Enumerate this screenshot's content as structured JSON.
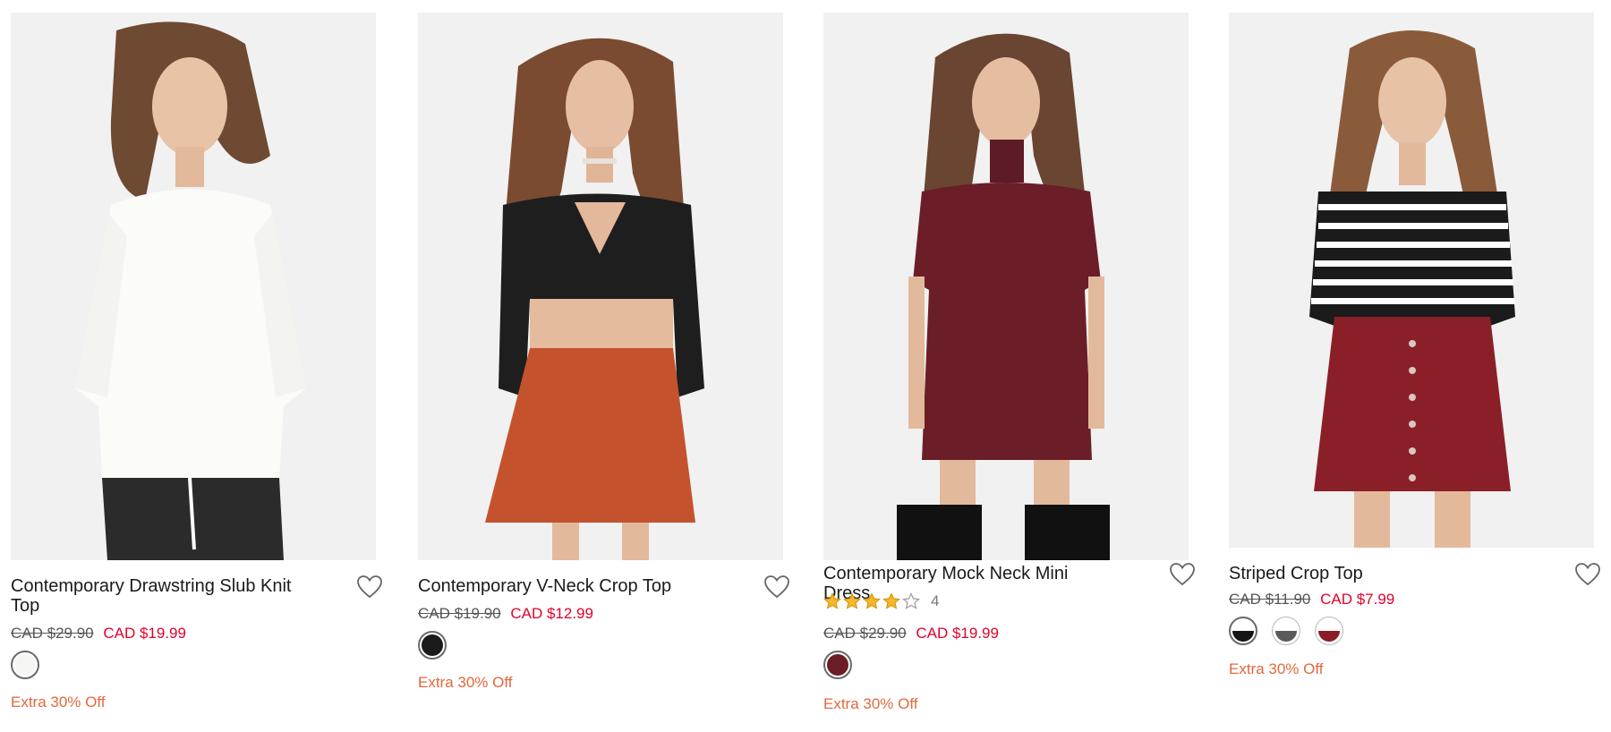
{
  "colors": {
    "sale": "#e4002b",
    "promo": "#e2683c",
    "star": "#f6b82a"
  },
  "products": [
    {
      "name": "Contemporary Drawstring Slub Knit Top",
      "price_original": "CAD $29.90",
      "price_sale": "CAD $19.99",
      "promo": "Extra 30% Off",
      "wishlist_icon": "heart-outline-icon",
      "swatches": [
        {
          "color": "#f6f6f4",
          "half": null,
          "selected": true
        }
      ]
    },
    {
      "name": "Contemporary V-Neck Crop Top",
      "price_original": "CAD $19.90",
      "price_sale": "CAD $12.99",
      "promo": "Extra 30% Off",
      "wishlist_icon": "heart-outline-icon",
      "swatches": [
        {
          "color": "#1b1b1b",
          "half": null,
          "selected": true
        }
      ]
    },
    {
      "name": "Contemporary Mock Neck Mini Dress",
      "rating": 4,
      "rating_count": "4",
      "price_original": "CAD $29.90",
      "price_sale": "CAD $19.99",
      "promo": "Extra 30% Off",
      "wishlist_icon": "heart-outline-icon",
      "swatches": [
        {
          "color": "#6b1e27",
          "half": null,
          "selected": true
        }
      ]
    },
    {
      "name": "Striped Crop Top",
      "price_original": "CAD $11.90",
      "price_sale": "CAD $7.99",
      "promo": "Extra 30% Off",
      "wishlist_icon": "heart-outline-icon",
      "swatches": [
        {
          "color": "#ffffff",
          "half": "#151515",
          "selected": true
        },
        {
          "color": "#ffffff",
          "half": "#5b5b5b",
          "selected": false
        },
        {
          "color": "#ffffff",
          "half": "#8a1c26",
          "selected": false
        }
      ]
    }
  ]
}
